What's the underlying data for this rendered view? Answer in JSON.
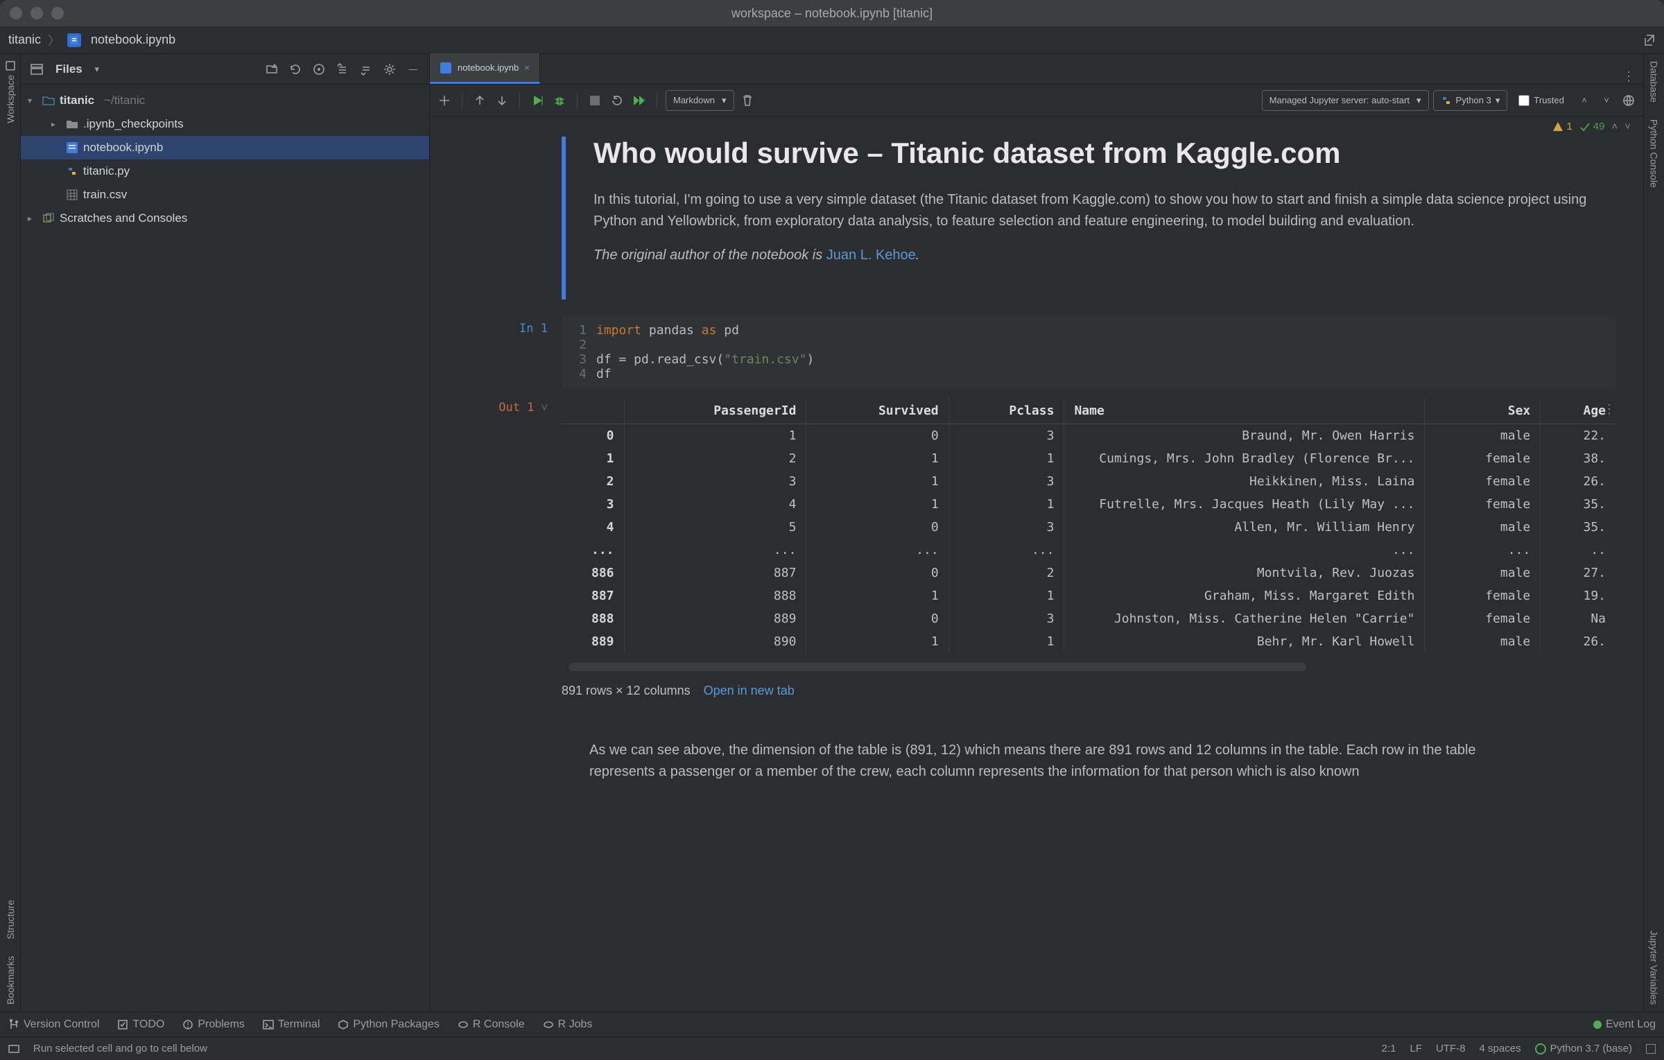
{
  "window": {
    "title": "workspace – notebook.ipynb [titanic]"
  },
  "breadcrumb": {
    "project": "titanic",
    "file": "notebook.ipynb"
  },
  "editor_tab": {
    "label": "notebook.ipynb"
  },
  "left_tools": {
    "workspace": "Workspace",
    "structure": "Structure",
    "bookmarks": "Bookmarks"
  },
  "right_tools": {
    "database": "Database",
    "python_console": "Python Console",
    "jupyter_vars": "Jupyter Variables"
  },
  "sidebar": {
    "view_label": "Files",
    "root": {
      "name": "titanic",
      "path": "~/titanic"
    },
    "items": [
      {
        "name": ".ipynb_checkpoints",
        "kind": "folder"
      },
      {
        "name": "notebook.ipynb",
        "kind": "nb",
        "selected": true
      },
      {
        "name": "titanic.py",
        "kind": "py"
      },
      {
        "name": "train.csv",
        "kind": "csv"
      }
    ],
    "scratches": "Scratches and Consoles"
  },
  "toolbar": {
    "cell_type": "Markdown",
    "server": "Managed Jupyter server: auto-start",
    "kernel": "Python 3",
    "trusted": "Trusted"
  },
  "problems": {
    "warnings": "1",
    "weak": "49"
  },
  "md": {
    "h1": "Who would survive – Titanic dataset from Kaggle.com",
    "p1": "In this tutorial, I'm going to use a very simple dataset (the Titanic dataset from Kaggle.com) to show you how to start and finish a simple data science project using Python and Yellowbrick, from exploratory data analysis, to feature selection and feature engineering, to model building and evaluation.",
    "p2_a": "The original author of the notebook is ",
    "p2_link": "Juan L. Kehoe",
    "p2_b": "."
  },
  "code": {
    "prompt": "In 1",
    "lines": {
      "1": "1",
      "2": "2",
      "3": "3",
      "4": "4"
    },
    "l1_import": "import",
    "l1_pandas": " pandas ",
    "l1_as": "as",
    "l1_pd": " pd",
    "l3_a": "df = pd.read_csv(",
    "l3_str": "\"train.csv\"",
    "l3_b": ")",
    "l4": "df"
  },
  "out": {
    "prompt": "Out 1",
    "headers": [
      "",
      "PassengerId",
      "Survived",
      "Pclass",
      "Name",
      "Sex",
      "Age"
    ],
    "rows": [
      [
        "0",
        "1",
        "0",
        "3",
        "Braund, Mr. Owen Harris",
        "male",
        "22."
      ],
      [
        "1",
        "2",
        "1",
        "1",
        "Cumings, Mrs. John Bradley (Florence Br...",
        "female",
        "38."
      ],
      [
        "2",
        "3",
        "1",
        "3",
        "Heikkinen, Miss. Laina",
        "female",
        "26."
      ],
      [
        "3",
        "4",
        "1",
        "1",
        "Futrelle, Mrs. Jacques Heath (Lily May ...",
        "female",
        "35."
      ],
      [
        "4",
        "5",
        "0",
        "3",
        "Allen, Mr. William Henry",
        "male",
        "35."
      ],
      [
        "...",
        "...",
        "...",
        "...",
        "...",
        "...",
        ".."
      ],
      [
        "886",
        "887",
        "0",
        "2",
        "Montvila, Rev. Juozas",
        "male",
        "27."
      ],
      [
        "887",
        "888",
        "1",
        "1",
        "Graham, Miss. Margaret Edith",
        "female",
        "19."
      ],
      [
        "888",
        "889",
        "0",
        "3",
        "Johnston, Miss. Catherine Helen \"Carrie\"",
        "female",
        "Na"
      ],
      [
        "889",
        "890",
        "1",
        "1",
        "Behr, Mr. Karl Howell",
        "male",
        "26."
      ]
    ],
    "caption": "891 rows × 12 columns",
    "open_link": "Open in new tab"
  },
  "md2": {
    "p": "As we can see above, the dimension of the table is (891, 12) which means there are 891 rows and 12 columns in the table. Each row in the table represents a passenger or a member of the crew, each column represents the information for that person which is also known"
  },
  "bottom": {
    "version": "Version Control",
    "todo": "TODO",
    "problems": "Problems",
    "terminal": "Terminal",
    "packages": "Python Packages",
    "rconsole": "R Console",
    "rjobs": "R Jobs",
    "event": "Event Log"
  },
  "status": {
    "hint": "Run selected cell and go to cell below",
    "pos": "2:1",
    "le": "LF",
    "enc": "UTF-8",
    "indent": "4 spaces",
    "interp": "Python 3.7 (base)"
  }
}
